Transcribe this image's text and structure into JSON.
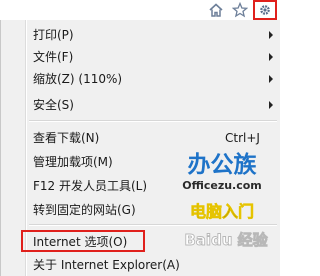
{
  "toolbar": {
    "home_icon": "home-icon",
    "star_icon": "star-icon",
    "gear_icon": "gear-icon",
    "accent": "#e0201c"
  },
  "menu": {
    "items": [
      {
        "label": "打印(P)",
        "submenu": true
      },
      {
        "label": "文件(F)",
        "submenu": true
      },
      {
        "label": "缩放(Z) (110%)",
        "submenu": true
      },
      {
        "label": "安全(S)",
        "submenu": true
      },
      {
        "label": "查看下载(N)",
        "shortcut": "Ctrl+J"
      },
      {
        "label": "管理加载项(M)"
      },
      {
        "label": "F12 开发人员工具(L)"
      },
      {
        "label": "转到固定的网站(G)"
      },
      {
        "label": "Internet 选项(O)"
      },
      {
        "label": "关于 Internet Explorer(A)"
      }
    ]
  },
  "watermark": {
    "logo_text": "办公族",
    "domain": "Officezu.com",
    "tagline": "电脑入门",
    "baidu": "Baidu 经验"
  }
}
